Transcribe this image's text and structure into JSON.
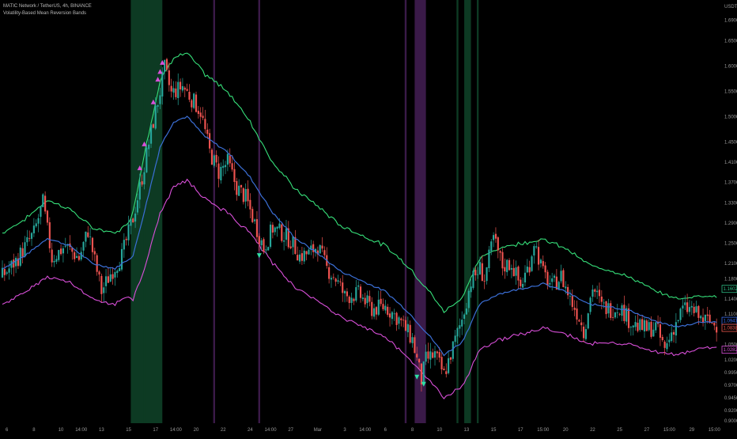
{
  "legend": {
    "symbol_line": "MATIC Network / TetherUS, 4h, BINANCE",
    "indicator_line": "Volatility-Based Mean Reversion Bands"
  },
  "currency_label": "USDT",
  "chart_data": {
    "type": "candlestick",
    "title": "MATIC Network / TetherUS, 4h, BINANCE",
    "indicator": "Volatility-Based Mean Reversion Bands",
    "ylim": [
      0.895,
      1.73
    ],
    "y_ticks": [
      "1.6900",
      "1.6500",
      "1.6000",
      "1.5500",
      "1.5000",
      "1.4500",
      "1.4100",
      "1.3700",
      "1.3300",
      "1.2900",
      "1.2500",
      "1.2100",
      "1.1800",
      "1.1400",
      "1.1100",
      "1.0800",
      "1.0500",
      "1.0200",
      "0.9950",
      "0.9700",
      "0.9450",
      "0.9200",
      "0.9000"
    ],
    "x_ticks": [
      {
        "label": "6",
        "i": 2
      },
      {
        "label": "8",
        "i": 14
      },
      {
        "label": "10",
        "i": 26
      },
      {
        "label": "14:00",
        "i": 35
      },
      {
        "label": "13",
        "i": 44
      },
      {
        "label": "15",
        "i": 56
      },
      {
        "label": "17",
        "i": 68
      },
      {
        "label": "14:00",
        "i": 77
      },
      {
        "label": "20",
        "i": 86
      },
      {
        "label": "22",
        "i": 98
      },
      {
        "label": "24",
        "i": 110
      },
      {
        "label": "14:00",
        "i": 119
      },
      {
        "label": "27",
        "i": 128
      },
      {
        "label": "Mar",
        "i": 140
      },
      {
        "label": "3",
        "i": 152
      },
      {
        "label": "14:00",
        "i": 161
      },
      {
        "label": "6",
        "i": 170
      },
      {
        "label": "8",
        "i": 182
      },
      {
        "label": "10",
        "i": 194
      },
      {
        "label": "13",
        "i": 206
      },
      {
        "label": "15",
        "i": 218
      },
      {
        "label": "17",
        "i": 230
      },
      {
        "label": "15:00",
        "i": 240
      },
      {
        "label": "20",
        "i": 250
      },
      {
        "label": "22",
        "i": 262
      },
      {
        "label": "25",
        "i": 274
      },
      {
        "label": "27",
        "i": 286
      },
      {
        "label": "15:00",
        "i": 296
      },
      {
        "label": "29",
        "i": 306
      },
      {
        "label": "15:00",
        "i": 316
      }
    ],
    "close_anchors": [
      [
        0,
        1.185
      ],
      [
        6,
        1.215
      ],
      [
        14,
        1.27
      ],
      [
        18,
        1.33
      ],
      [
        22,
        1.22
      ],
      [
        28,
        1.245
      ],
      [
        34,
        1.22
      ],
      [
        38,
        1.275
      ],
      [
        44,
        1.155
      ],
      [
        48,
        1.19
      ],
      [
        53,
        1.225
      ],
      [
        58,
        1.3
      ],
      [
        62,
        1.38
      ],
      [
        66,
        1.47
      ],
      [
        70,
        1.55
      ],
      [
        72,
        1.595
      ],
      [
        75,
        1.545
      ],
      [
        80,
        1.56
      ],
      [
        84,
        1.535
      ],
      [
        88,
        1.51
      ],
      [
        92,
        1.43
      ],
      [
        96,
        1.39
      ],
      [
        100,
        1.41
      ],
      [
        104,
        1.36
      ],
      [
        108,
        1.34
      ],
      [
        112,
        1.29
      ],
      [
        116,
        1.24
      ],
      [
        120,
        1.28
      ],
      [
        124,
        1.27
      ],
      [
        128,
        1.255
      ],
      [
        132,
        1.225
      ],
      [
        136,
        1.23
      ],
      [
        140,
        1.245
      ],
      [
        144,
        1.2
      ],
      [
        148,
        1.18
      ],
      [
        152,
        1.145
      ],
      [
        158,
        1.15
      ],
      [
        164,
        1.12
      ],
      [
        170,
        1.125
      ],
      [
        176,
        1.1
      ],
      [
        182,
        1.06
      ],
      [
        186,
        0.98
      ],
      [
        188,
        1.02
      ],
      [
        192,
        1.03
      ],
      [
        196,
        0.99
      ],
      [
        200,
        1.045
      ],
      [
        204,
        1.1
      ],
      [
        208,
        1.175
      ],
      [
        212,
        1.2
      ],
      [
        214,
        1.18
      ],
      [
        218,
        1.26
      ],
      [
        222,
        1.205
      ],
      [
        226,
        1.21
      ],
      [
        230,
        1.165
      ],
      [
        234,
        1.21
      ],
      [
        236,
        1.255
      ],
      [
        240,
        1.19
      ],
      [
        244,
        1.165
      ],
      [
        248,
        1.185
      ],
      [
        252,
        1.14
      ],
      [
        256,
        1.105
      ],
      [
        258,
        1.075
      ],
      [
        262,
        1.165
      ],
      [
        266,
        1.125
      ],
      [
        270,
        1.12
      ],
      [
        274,
        1.125
      ],
      [
        278,
        1.1
      ],
      [
        282,
        1.085
      ],
      [
        286,
        1.08
      ],
      [
        290,
        1.085
      ],
      [
        294,
        1.04
      ],
      [
        298,
        1.085
      ],
      [
        302,
        1.12
      ],
      [
        306,
        1.12
      ],
      [
        310,
        1.1
      ],
      [
        314,
        1.095
      ],
      [
        316,
        1.09
      ]
    ],
    "basis_anchors": [
      [
        0,
        1.2
      ],
      [
        10,
        1.225
      ],
      [
        20,
        1.26
      ],
      [
        30,
        1.245
      ],
      [
        40,
        1.21
      ],
      [
        50,
        1.2
      ],
      [
        58,
        1.225
      ],
      [
        64,
        1.33
      ],
      [
        70,
        1.44
      ],
      [
        76,
        1.49
      ],
      [
        82,
        1.5
      ],
      [
        90,
        1.46
      ],
      [
        100,
        1.43
      ],
      [
        110,
        1.38
      ],
      [
        120,
        1.31
      ],
      [
        130,
        1.26
      ],
      [
        140,
        1.23
      ],
      [
        150,
        1.195
      ],
      [
        160,
        1.175
      ],
      [
        170,
        1.155
      ],
      [
        180,
        1.115
      ],
      [
        190,
        1.065
      ],
      [
        196,
        1.03
      ],
      [
        204,
        1.055
      ],
      [
        212,
        1.13
      ],
      [
        220,
        1.15
      ],
      [
        230,
        1.16
      ],
      [
        240,
        1.17
      ],
      [
        250,
        1.155
      ],
      [
        260,
        1.13
      ],
      [
        270,
        1.125
      ],
      [
        280,
        1.115
      ],
      [
        290,
        1.095
      ],
      [
        300,
        1.085
      ],
      [
        310,
        1.095
      ],
      [
        316,
        1.095
      ]
    ],
    "band_width_anchors": [
      [
        0,
        0.07
      ],
      [
        20,
        0.075
      ],
      [
        40,
        0.07
      ],
      [
        55,
        0.07
      ],
      [
        64,
        0.12
      ],
      [
        72,
        0.13
      ],
      [
        80,
        0.125
      ],
      [
        100,
        0.12
      ],
      [
        120,
        0.1
      ],
      [
        150,
        0.09
      ],
      [
        180,
        0.09
      ],
      [
        196,
        0.085
      ],
      [
        210,
        0.09
      ],
      [
        230,
        0.09
      ],
      [
        250,
        0.085
      ],
      [
        280,
        0.065
      ],
      [
        300,
        0.055
      ],
      [
        316,
        0.05
      ]
    ],
    "n_bars": 318,
    "highlight_bands": [
      {
        "from": 57,
        "to": 71,
        "color": "#0d3a23"
      },
      {
        "from": 183,
        "to": 188,
        "color": "#3a1a48"
      },
      {
        "from": 205,
        "to": 208,
        "color": "#0d3a23"
      }
    ],
    "vertical_lines": [
      {
        "i": 63,
        "color": "#0d3a23"
      },
      {
        "i": 94,
        "color": "#3a1a48"
      },
      {
        "i": 114,
        "color": "#3a1a48"
      },
      {
        "i": 179,
        "color": "#3a1a48"
      },
      {
        "i": 202,
        "color": "#0d3a23"
      },
      {
        "i": 211,
        "color": "#0d3a23"
      }
    ],
    "overbought_signals": [
      61,
      63,
      67,
      69,
      70,
      71
    ],
    "oversold_signals": [
      114,
      184,
      187
    ],
    "price_badges": [
      {
        "label": "1.1602",
        "value": 1.16,
        "color": "#2ebd85"
      },
      {
        "label": "1.0947",
        "value": 1.097,
        "color": "#3a6df0"
      },
      {
        "label": "1.0838",
        "value": 1.083,
        "color": "#f0584e"
      },
      {
        "label": "1.0282",
        "value": 1.04,
        "color": "#d94fd9"
      }
    ],
    "colors": {
      "up": "#26a69a",
      "down": "#ef5350",
      "upper": "#36e07a",
      "basis": "#3b6fd6",
      "lower": "#d94fd9",
      "overbought": "#d94fd9",
      "oversold": "#2ee0a4"
    }
  }
}
